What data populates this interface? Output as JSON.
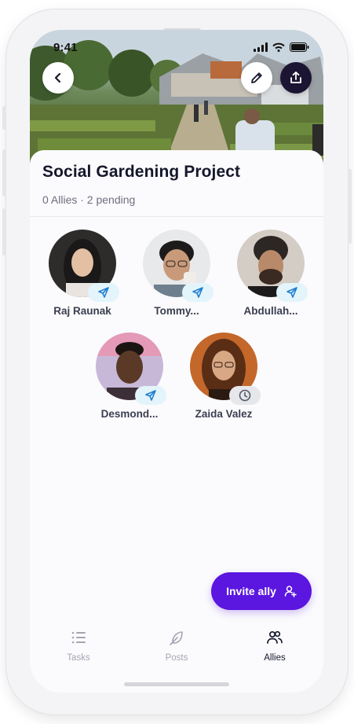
{
  "status": {
    "time": "9:41"
  },
  "project": {
    "title": "Social Gardening Project",
    "summary": "0 Allies · 2 pending"
  },
  "allies": [
    {
      "name": "Raj Raunak",
      "status": "sent"
    },
    {
      "name": "Tommy...",
      "status": "sent"
    },
    {
      "name": "Abdullah...",
      "status": "sent"
    },
    {
      "name": "Desmond...",
      "status": "sent"
    },
    {
      "name": "Zaida Valez",
      "status": "pending"
    }
  ],
  "actions": {
    "invite_label": "Invite ally"
  },
  "tabs": [
    {
      "label": "Tasks",
      "active": false
    },
    {
      "label": "Posts",
      "active": false
    },
    {
      "label": "Allies",
      "active": true
    }
  ],
  "colors": {
    "accent": "#5b16e0",
    "sent_badge_bg": "#e3f4fb",
    "sent_icon": "#1f7fd1",
    "pending_badge_bg": "#e6e7ea",
    "tab_inactive": "#a3a5b3",
    "tab_active": "#15172b"
  },
  "icons": {
    "back": "chevron-left-icon",
    "edit": "pencil-icon",
    "share": "share-icon",
    "sent": "send-icon",
    "pending": "clock-icon",
    "invite": "add-user-icon"
  }
}
